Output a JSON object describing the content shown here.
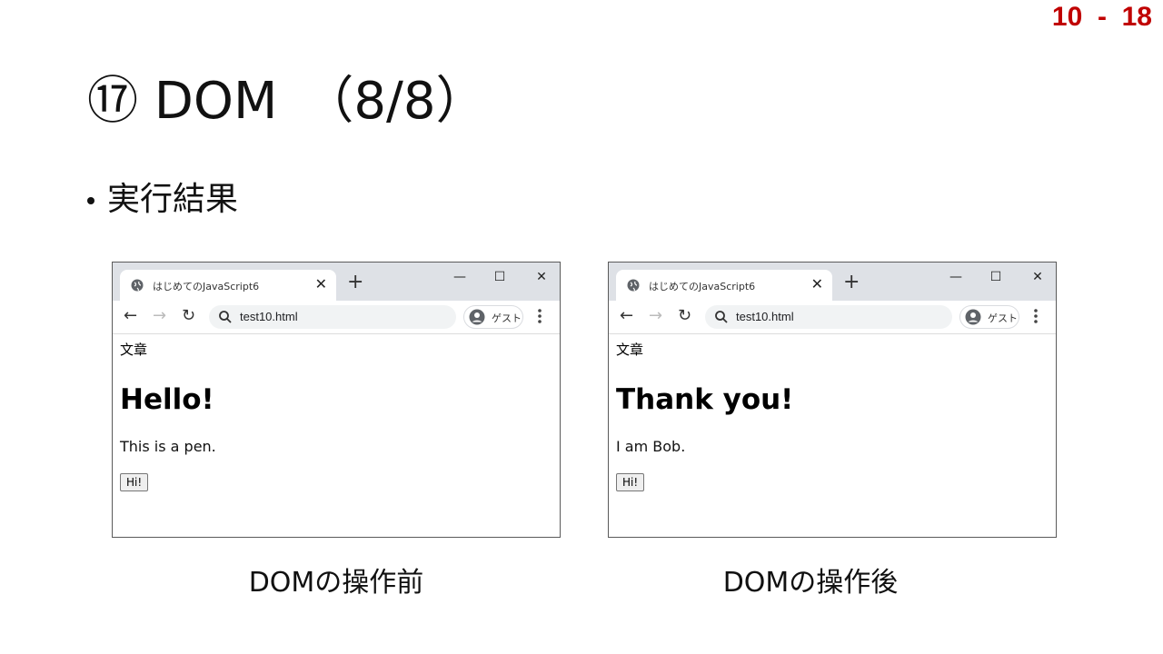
{
  "page_number": "10  -  18",
  "slide_title": "⑰ DOM　（8/8）",
  "bullet": "実行結果",
  "browsers": [
    {
      "tab_title": "はじめてのJavaScript6",
      "url": "test10.html",
      "profile_label": "ゲスト",
      "page": {
        "label": "文章",
        "heading": "Hello!",
        "paragraph": "This is a pen.",
        "button": "Hi!"
      },
      "caption": "DOMの操作前"
    },
    {
      "tab_title": "はじめてのJavaScript6",
      "url": "test10.html",
      "profile_label": "ゲスト",
      "page": {
        "label": "文章",
        "heading": "Thank you!",
        "paragraph": "I am Bob.",
        "button": "Hi!"
      },
      "caption": "DOMの操作後"
    }
  ],
  "icons": {
    "tab_close": "✕",
    "new_tab": "+",
    "minimize": "—",
    "maximize": "☐",
    "close": "✕",
    "back": "←",
    "forward": "→",
    "reload": "↻"
  }
}
